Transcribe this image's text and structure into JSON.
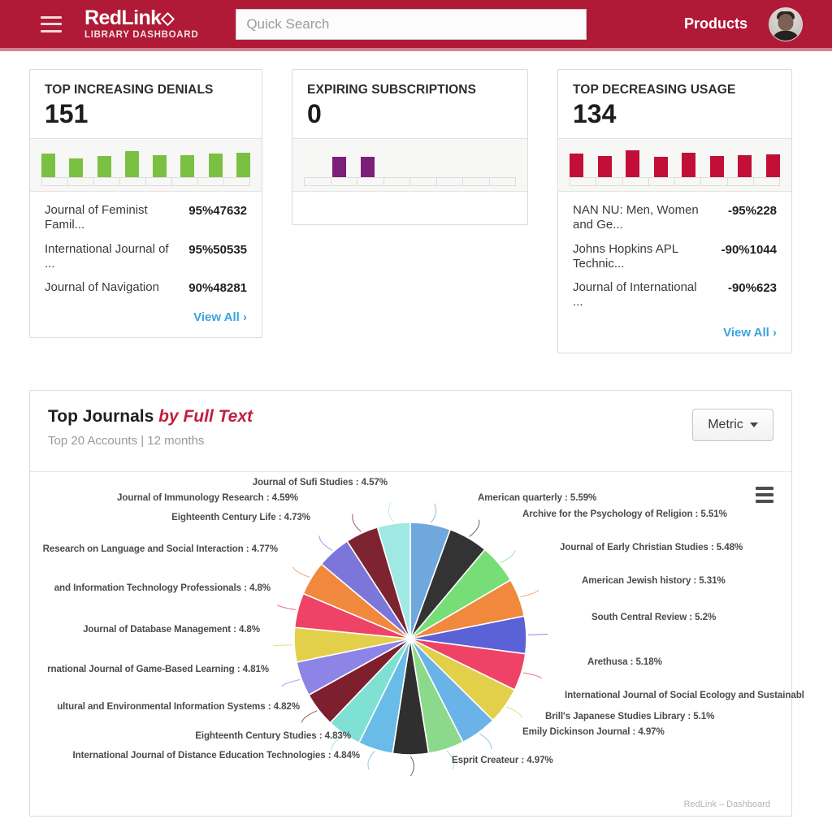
{
  "header": {
    "menu_icon": "hamburger-icon",
    "brand_name": "RedLink",
    "brand_glyph": "◇",
    "brand_subtitle": "LIBRARY DASHBOARD",
    "search_placeholder": "Quick Search",
    "search_value": "",
    "products_label": "Products",
    "avatar_name": "user-avatar",
    "bg_color": "#b01a36"
  },
  "cards": [
    {
      "id": "top-increasing-denials",
      "title": "TOP INCREASING DENIALS",
      "value": "151",
      "bar_color": "#7ac143",
      "bars": [
        30,
        24,
        27,
        33,
        28,
        28,
        30,
        31
      ],
      "rows": [
        {
          "name": "Journal of Feminist Famil...",
          "value": "95%47632"
        },
        {
          "name": "International Journal of ...",
          "value": "95%50535"
        },
        {
          "name": "Journal of Navigation",
          "value": "90%48281"
        }
      ],
      "view_all": "View All ›",
      "has_view_all": true
    },
    {
      "id": "expiring-subscriptions",
      "title": "EXPIRING SUBSCRIPTIONS",
      "value": "0",
      "bar_color": "#7b1f78",
      "bars": [
        0,
        26,
        26,
        0,
        0,
        0,
        0,
        0
      ],
      "rows": [],
      "view_all": "",
      "has_view_all": false
    },
    {
      "id": "top-decreasing-usage",
      "title": "TOP DECREASING USAGE",
      "value": "134",
      "bar_color": "#c10f38",
      "bars": [
        30,
        27,
        34,
        26,
        31,
        27,
        28,
        29
      ],
      "rows": [
        {
          "name": "NAN NU: Men, Women and Ge...",
          "value": "-95%228"
        },
        {
          "name": "Johns Hopkins APL Technic...",
          "value": "-90%1044"
        },
        {
          "name": "Journal of International ...",
          "value": "-90%623"
        }
      ],
      "view_all": "View All ›",
      "has_view_all": true
    }
  ],
  "chart_panel": {
    "title_main": "Top Journals ",
    "title_accent": "by Full Text",
    "subtitle": "Top 20 Accounts | 12 months",
    "metric_button": "Metric",
    "export_icon": "hamburger-menu-icon",
    "credit": "RedLink – Dashboard"
  },
  "chart_data": {
    "type": "pie",
    "title": "Top Journals by Full Text",
    "subtitle": "Top 20 Accounts | 12 months",
    "unit": "%",
    "legend": "labels-outside",
    "grid": false,
    "labels": [
      "American quarterly",
      "Archive for the Psychology of Religion",
      "Journal of Early Christian Studies",
      "American Jewish history",
      "South Central Review",
      "Arethusa",
      "International Journal of Social Ecology and Sustainabl",
      "Brill's Japanese Studies Library",
      "Emily Dickinson Journal",
      "Esprit Createur",
      "International Journal of Distance Education Technologies",
      "Eighteenth Century Studies",
      "ultural and Environmental Information Systems",
      "rnational Journal of Game-Based Learning",
      "Journal of Database Management",
      "and Information Technology Professionals",
      "Research on Language and Social Interaction",
      "Eighteenth Century Life",
      "Journal of Immunology Research",
      "Journal of Sufi Studies"
    ],
    "values": [
      5.59,
      5.51,
      5.48,
      5.31,
      5.2,
      5.18,
      5.14,
      5.1,
      4.97,
      4.97,
      4.84,
      4.83,
      4.82,
      4.81,
      4.8,
      4.8,
      4.77,
      4.73,
      4.59,
      4.57
    ],
    "display_labels": [
      "American quarterly : 5.59%",
      "Archive for the Psychology of Religion : 5.51%",
      "Journal of Early Christian Studies : 5.48%",
      "American Jewish history : 5.31%",
      "South Central Review : 5.2%",
      "Arethusa : 5.18%",
      "International Journal of Social Ecology and Sustainabl",
      "Brill's Japanese Studies Library : 5.1%",
      "Emily Dickinson Journal : 4.97%",
      "Esprit Createur : 4.97%",
      "International Journal of Distance Education Technologies : 4.84%",
      "Eighteenth Century Studies : 4.83%",
      "ultural and Environmental Information Systems : 4.82%",
      "rnational Journal of Game-Based Learning : 4.81%",
      "Journal of Database Management : 4.8%",
      "and Information Technology Professionals : 4.8%",
      "Research on Language and Social Interaction : 4.77%",
      "Eighteenth Century Life : 4.73%",
      "Journal of Immunology Research : 4.59%",
      "Journal of Sufi Studies : 4.57%"
    ],
    "colors": [
      "#6FA8DC",
      "#333333",
      "#77DD77",
      "#F0883E",
      "#5B62D6",
      "#EE4266",
      "#E3D04A",
      "#69B3E8",
      "#8CD98C",
      "#2F2F2F",
      "#69BCE8",
      "#7FE0D4",
      "#7E1F2E",
      "#8D84E8",
      "#E3D04A",
      "#EE4266",
      "#F0883E",
      "#7C76DB",
      "#7E2430",
      "#9FE8E4"
    ]
  }
}
